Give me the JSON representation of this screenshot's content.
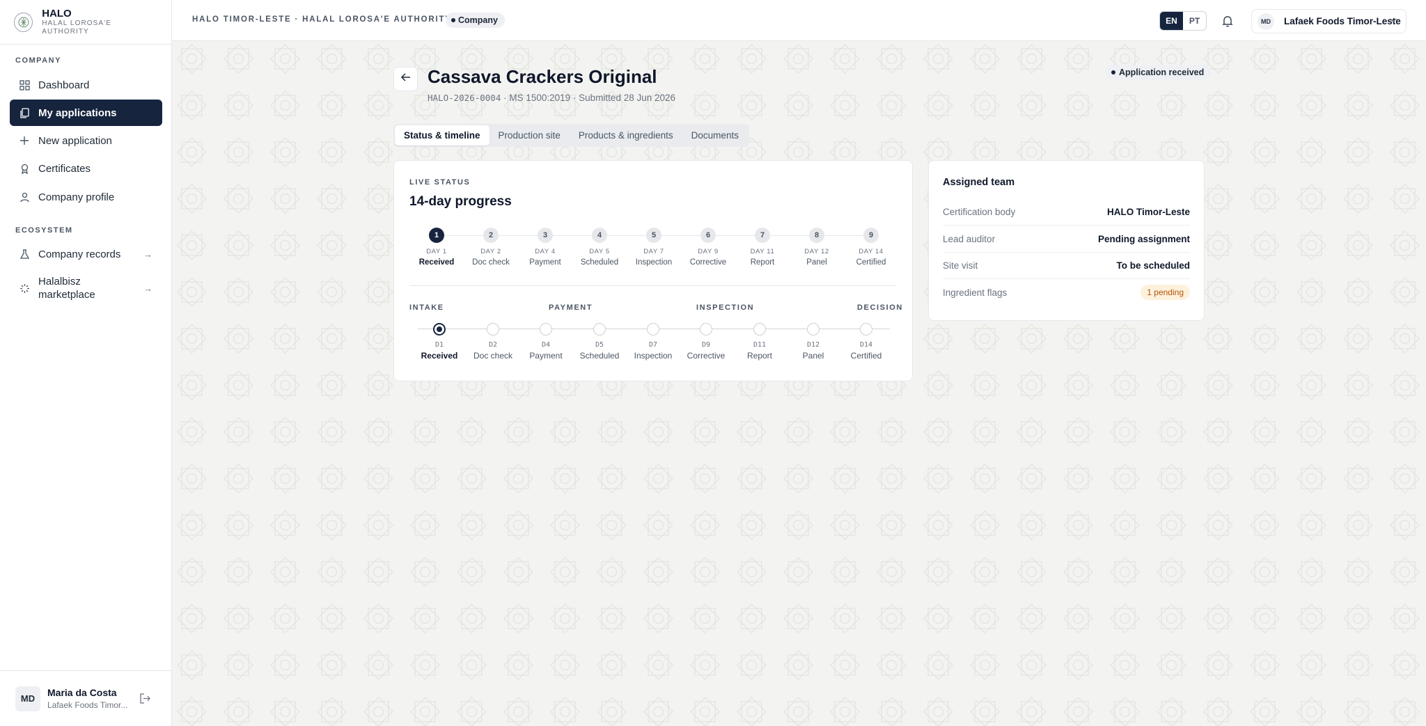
{
  "brand": {
    "name": "HALO",
    "subtitle": "HALAL LOROSA'E AUTHORITY"
  },
  "sidebar": {
    "sections": [
      {
        "label": "COMPANY"
      },
      {
        "label": "ECOSYSTEM"
      }
    ],
    "items": [
      {
        "label": "Dashboard",
        "icon": "grid-icon"
      },
      {
        "label": "My applications",
        "icon": "copy-icon",
        "active": true
      },
      {
        "label": "New application",
        "icon": "plus-icon"
      },
      {
        "label": "Certificates",
        "icon": "award-icon"
      },
      {
        "label": "Company profile",
        "icon": "user-icon"
      },
      {
        "label": "Company records",
        "icon": "flask-icon"
      },
      {
        "label": "Halalbisz marketplace",
        "icon": "sparkle-icon"
      }
    ],
    "user": {
      "initials": "MD",
      "name": "Maria da Costa",
      "org": "Lafaek Foods Timor..."
    }
  },
  "header": {
    "title": "HALO TIMOR-LESTE · HALAL LOROSA'E AUTHORITY",
    "role_badge": "Company",
    "lang": [
      "EN",
      "PT"
    ],
    "lang_active": "EN",
    "company": {
      "initials": "MD",
      "name": "Lafaek Foods Timor-Leste"
    }
  },
  "application": {
    "title": "Cassava Crackers Original",
    "ref": "HALO-2026-0004",
    "meta_rest": " · MS 1500:2019 · Submitted 28 Jun 2026",
    "status": "Application received"
  },
  "tabs": [
    "Status & timeline",
    "Production site",
    "Products & ingredients",
    "Documents"
  ],
  "progress": {
    "eyebrow": "LIVE STATUS",
    "title": "14-day progress",
    "steps": [
      {
        "num": "1",
        "day": "DAY 1",
        "label": "Received"
      },
      {
        "num": "2",
        "day": "DAY 2",
        "label": "Doc check"
      },
      {
        "num": "3",
        "day": "DAY 4",
        "label": "Payment"
      },
      {
        "num": "4",
        "day": "DAY 5",
        "label": "Scheduled"
      },
      {
        "num": "5",
        "day": "DAY 7",
        "label": "Inspection"
      },
      {
        "num": "6",
        "day": "DAY 9",
        "label": "Corrective"
      },
      {
        "num": "7",
        "day": "DAY 11",
        "label": "Report"
      },
      {
        "num": "8",
        "day": "DAY 12",
        "label": "Panel"
      },
      {
        "num": "9",
        "day": "DAY 14",
        "label": "Certified"
      }
    ],
    "phases": [
      "INTAKE",
      "PAYMENT",
      "INSPECTION",
      "DECISION"
    ],
    "timeline": [
      {
        "code": "D1",
        "label": "Received"
      },
      {
        "code": "D2",
        "label": "Doc check"
      },
      {
        "code": "D4",
        "label": "Payment"
      },
      {
        "code": "D5",
        "label": "Scheduled"
      },
      {
        "code": "D7",
        "label": "Inspection"
      },
      {
        "code": "D9",
        "label": "Corrective"
      },
      {
        "code": "D11",
        "label": "Report"
      },
      {
        "code": "D12",
        "label": "Panel"
      },
      {
        "code": "D14",
        "label": "Certified"
      }
    ]
  },
  "team": {
    "title": "Assigned team",
    "rows": [
      {
        "key": "Certification body",
        "value": "HALO Timor-Leste"
      },
      {
        "key": "Lead auditor",
        "value": "Pending assignment"
      },
      {
        "key": "Site visit",
        "value": "To be scheduled"
      },
      {
        "key": "Ingredient flags",
        "value": "1 pending"
      }
    ]
  }
}
